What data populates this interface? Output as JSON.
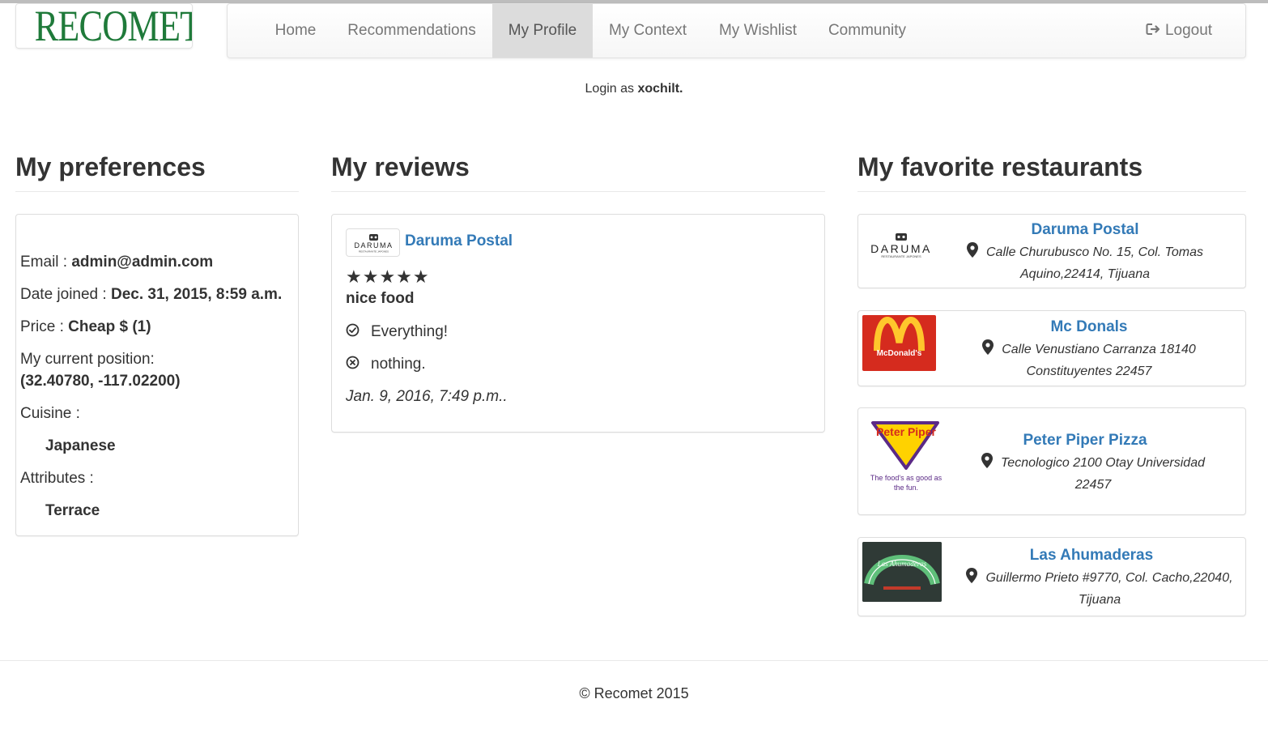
{
  "brand": {
    "logo_text": "RECOMET",
    "logo_color": "#1f7a3a"
  },
  "nav": {
    "items": [
      {
        "label": "Home"
      },
      {
        "label": "Recommendations"
      },
      {
        "label": "My Profile",
        "active": true
      },
      {
        "label": "My Context"
      },
      {
        "label": "My Wishlist"
      },
      {
        "label": "Community"
      }
    ],
    "logout_label": "Logout",
    "logout_icon": "logout-icon"
  },
  "login": {
    "prefix": "Login as",
    "username": "xochilt."
  },
  "preferences": {
    "title": "My preferences",
    "email_label": "Email :",
    "email": "admin@admin.com",
    "joined_label": "Date joined :",
    "joined": "Dec. 31, 2015, 8:59 a.m.",
    "price_label": "Price :",
    "price": "Cheap $ (1)",
    "position_label": "My current position:",
    "position": "(32.40780, -117.02200)",
    "cuisine_label": "Cuisine :",
    "cuisine": "Japanese",
    "attributes_label": "Attributes :",
    "attribute": "Terrace"
  },
  "reviews": {
    "title": "My reviews",
    "items": [
      {
        "restaurant": "Daruma Postal",
        "logo_text": "DARUMA",
        "logo_sub": "RESTAURANTE JAPONES",
        "stars": "★★★★★",
        "rating": 5,
        "headline": "nice food",
        "pros": "Everything!",
        "cons": "nothing.",
        "date": "Jan. 9, 2016, 7:49 p.m.."
      }
    ]
  },
  "favorites": {
    "title": "My favorite restaurants",
    "items": [
      {
        "name": "Daruma Postal",
        "address": "Calle Churubusco No. 15, Col. Tomas Aquino,22414, Tijuana",
        "logo_text": "DARUMA",
        "logo_sub": "RESTAURANTE JAPONES"
      },
      {
        "name": "Mc Donals",
        "address": "Calle Venustiano Carranza 18140 Constituyentes 22457",
        "logo_text": "McDonald's"
      },
      {
        "name": "Peter Piper Pizza",
        "address": "Tecnologico 2100 Otay Universidad 22457",
        "logo_text": "Peter Piper",
        "logo_tag": "The food's as good as the fun."
      },
      {
        "name": "Las Ahumaderas",
        "address": "Guillermo Prieto #9770, Col. Cacho,22040, Tijuana",
        "logo_text": "Las Ahumaderas"
      }
    ]
  },
  "footer": {
    "text": "© Recomet 2015"
  },
  "colors": {
    "link": "#337ab7",
    "nav_active_bg": "#dcdcdc",
    "text": "#333333"
  }
}
